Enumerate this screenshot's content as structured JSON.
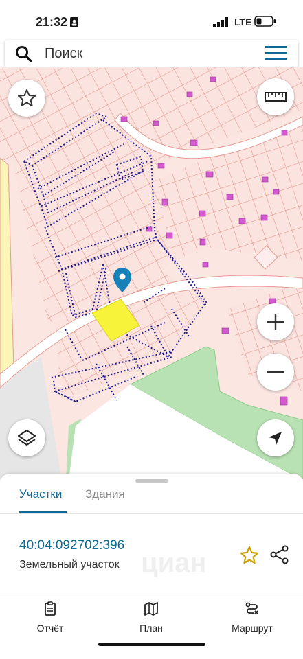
{
  "status_bar": {
    "time": "21:32",
    "network": "LTE"
  },
  "search": {
    "placeholder": "Поиск"
  },
  "map": {
    "icons": {
      "favorite": "star-icon",
      "ruler": "ruler-icon",
      "layers": "layers-icon",
      "zoom_in": "plus-icon",
      "zoom_out": "minus-icon",
      "location": "navigation-arrow-icon",
      "marker": "map-pin-icon"
    },
    "colors": {
      "parcel_fill": "#fbe3df",
      "parcel_stroke": "#e49b91",
      "selected_parcel": "#f7f33a",
      "dotted_boundary": "#1d1a8f",
      "green_area": "#9bd59b",
      "yellow_area": "#fbf6b8",
      "building": "#d25bd0",
      "marker": "#1681b8"
    }
  },
  "sheet": {
    "tabs": [
      {
        "label": "Участки",
        "active": true
      },
      {
        "label": "Здания",
        "active": false
      }
    ],
    "parcel": {
      "cadastral_number": "40:04:092702:396",
      "type": "Земельный участок"
    },
    "watermark": "циан"
  },
  "bottom_nav": [
    {
      "label": "Отчёт",
      "icon": "report-icon"
    },
    {
      "label": "План",
      "icon": "map-icon"
    },
    {
      "label": "Маршрут",
      "icon": "route-icon"
    }
  ],
  "accent_color": "#0d6a94"
}
